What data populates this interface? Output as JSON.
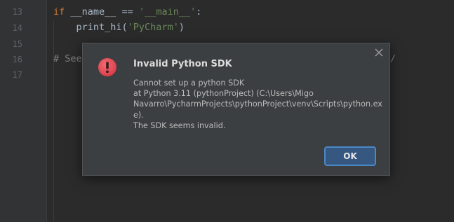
{
  "editor": {
    "line_numbers": [
      "13",
      "14",
      "15",
      "16",
      "17"
    ],
    "lines": {
      "l13": {
        "kw": "if",
        "rest": " __name__ == ",
        "str": "'__main__'",
        "tail": ":"
      },
      "l14": {
        "fn": "    print_hi(",
        "str": "'PyCharm'",
        "tail": ")"
      },
      "l16": {
        "cmt": "# See",
        "cmt_tail": "/"
      }
    }
  },
  "dialog": {
    "title": "Invalid Python SDK",
    "message_lines": [
      "Cannot set up a python SDK",
      "at Python 3.11 (pythonProject) (C:\\Users\\Migo",
      "Navarro\\PycharmProjects\\pythonProject\\venv\\Scripts\\python.ex",
      "e).",
      "The SDK seems invalid."
    ],
    "ok_label": "OK",
    "icons": {
      "error": "error-icon",
      "close": "close-icon"
    }
  },
  "colors": {
    "editor_bg": "#2b2b2b",
    "dialog_bg": "#3c3f41",
    "error_red": "#e0454f",
    "ok_border": "#4a88c7"
  }
}
